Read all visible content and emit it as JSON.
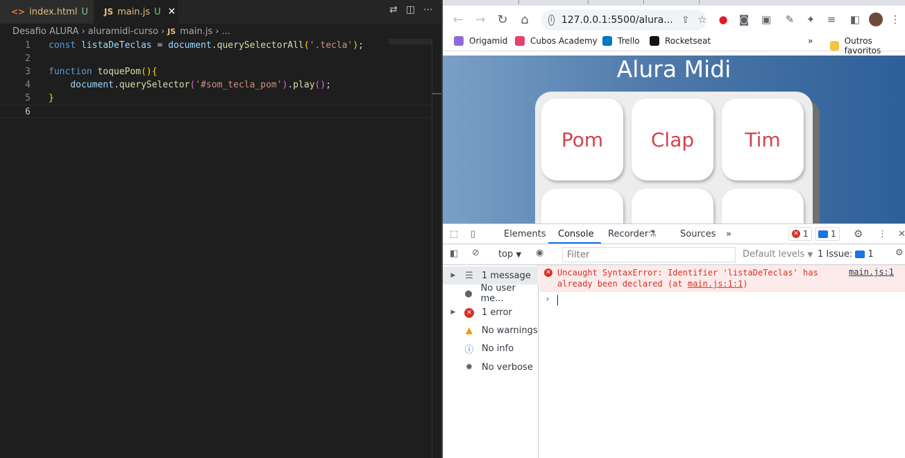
{
  "vscode": {
    "tabs": [
      {
        "label": "index.html",
        "status": "U",
        "icon": "<>"
      },
      {
        "label": "main.js",
        "status": "U",
        "icon": "JS"
      }
    ],
    "breadcrumb": [
      "Desafio ALURA",
      "aluramidi-curso",
      "main.js",
      "..."
    ],
    "line_numbers": [
      "1",
      "2",
      "3",
      "4",
      "5",
      "6"
    ],
    "code": {
      "l1_kw": "const",
      "l1_var": "listaDeTeclas",
      "l1_eq": " = ",
      "l1_obj": "document",
      "l1_fn": "querySelectorAll",
      "l1_str": "'.tecla'",
      "l3_kw": "function",
      "l3_fn": "toquePom",
      "l4_obj": "document",
      "l4_fn": "querySelector",
      "l4_str": "'#som_tecla_pom'",
      "l4_fn2": "play",
      "l5": "}"
    }
  },
  "browser": {
    "url": "127.0.0.1:5500/alura...",
    "bookmarks": [
      "Origamid",
      "Cubos Academy",
      "Trello",
      "Rocketseat",
      "Outros favoritos"
    ],
    "page_title": "Alura Midi",
    "keys": [
      "Pom",
      "Clap",
      "Tim"
    ]
  },
  "devtools": {
    "tabs": [
      "Elements",
      "Console",
      "Recorder",
      "Sources"
    ],
    "error_count": "1",
    "message_count": "1",
    "context": "top",
    "filter_placeholder": "Filter",
    "levels": "Default levels",
    "issues": "1 Issue:",
    "issues_count": "1",
    "sidebar": [
      "1 message",
      "No user me...",
      "1 error",
      "No warnings",
      "No info",
      "No verbose"
    ],
    "error_message_line1": "Uncaught SyntaxError: Identifier 'listaDeTeclas' has",
    "error_message_line2_prefix": "already been declared (at ",
    "error_message_line2_link": "main.js:1:1",
    "error_message_line2_suffix": ")",
    "error_source": "main.js:1"
  },
  "colors": {
    "error_red": "#d93025",
    "key_text": "#d6414e",
    "accent_blue": "#1a73e8"
  }
}
